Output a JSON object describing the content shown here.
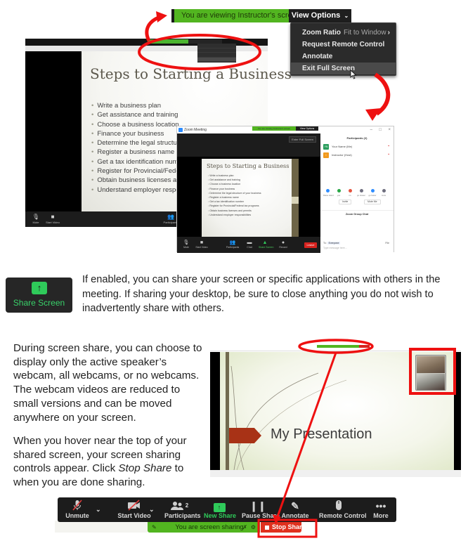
{
  "figure1": {
    "viewing_banner": "You are viewing Instructor's screen",
    "view_options_label": "View Options",
    "view_menu": [
      {
        "label": "Zoom Ratio",
        "sub": "Fit to Window",
        "has_submenu": true
      },
      {
        "label": "Request Remote Control"
      },
      {
        "label": "Annotate"
      },
      {
        "label": "Exit Full Screen",
        "highlighted": true
      }
    ],
    "slide": {
      "title": "Steps to Starting a Business",
      "bullets": [
        "Write a business plan",
        "Get assistance and training",
        "Choose a business location",
        "Finance your business",
        "Determine the legal structure of your business",
        "Register a business name",
        "Get a tax identification number",
        "Register for Provincial/Federal tax programs",
        "Obtain business licenses and permits",
        "Understand employer responsibilities"
      ]
    },
    "big_window_controls": {
      "mute": "Mute",
      "start_video": "Start Video",
      "participants": "Participants"
    },
    "zoom_window": {
      "title": "Zoom Meeting",
      "enter_full_screen": "Enter Full Screen",
      "controls": [
        "Mute",
        "Start Video",
        "Participants",
        "Chat",
        "Share Screen",
        "Record"
      ],
      "leave": "Leave",
      "participants_header": "Participants (2)",
      "participants": [
        {
          "initials": "YN",
          "name": "Your Name (Me)",
          "color": "#2a9d5c"
        },
        {
          "initials": "I",
          "name": "Instructor (Host)",
          "color": "#f29a1e"
        }
      ],
      "reactions": [
        "Raise Hand",
        "yes",
        "no",
        "go slower",
        "go faster",
        "more"
      ],
      "invite": "Invite",
      "mute_me": "Mute Me",
      "chat_header": "Zoom Group Chat",
      "chat_to_label": "To:",
      "chat_to_value": "Everyone",
      "chat_file": "File",
      "chat_placeholder": "Type message here..."
    }
  },
  "share_section": {
    "button_label": "Share Screen",
    "description": "If enabled, you can share your screen or specific applications with others in the meeting. If sharing your desktop, be sure to close anything you do not wish to inadvertently share with others."
  },
  "screen_share_section": {
    "para1": "During screen share, you can choose to display only the active speaker’s webcam, all webcams, or no webcams. The webcam videos are reduced to small versions and can be moved anywhere on your screen.",
    "para2_before": "When you hover near the top of your shared screen, your screen sharing controls appear. Click ",
    "para2_em": "Stop Share",
    "para2_after": " to when you are done sharing.",
    "presentation_title": "My Presentation"
  },
  "toolbar": {
    "unmute": "Unmute",
    "start_video": "Start Video",
    "participants": "Participants",
    "participants_count": "2",
    "new_share": "New Share",
    "pause_share": "Pause Share",
    "annotate": "Annotate",
    "remote_control": "Remote Control",
    "more": "More",
    "sharing_banner": "You are screen sharing",
    "stop_share": "Stop Share"
  },
  "colors": {
    "zoom_green": "#52b520",
    "share_green": "#2fca5a",
    "stop_red": "#e0311e",
    "annotation_red": "#ee1111"
  }
}
